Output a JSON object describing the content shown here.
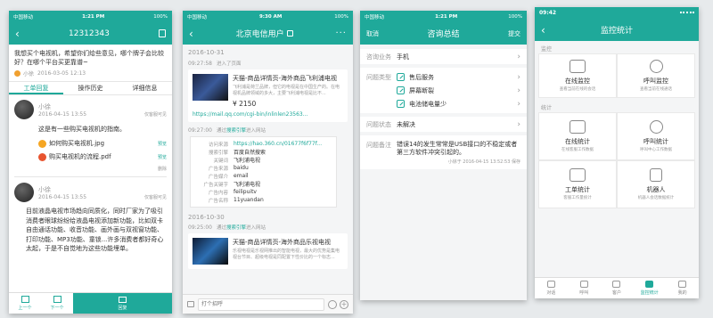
{
  "p1": {
    "status": {
      "carrier": "中国移动",
      "time": "1:21 PM",
      "battery": "100%"
    },
    "title": "12312343",
    "question": "我想买个电视机，希望你们给些意见，哪个牌子会比较好？在哪个平台买更靠谱~",
    "asker": "小徐",
    "asker_date": "2016-03-05 12:13",
    "tabs": [
      "工单回复",
      "操作历史",
      "详细信息"
    ],
    "r1": {
      "name": "小徐",
      "time": "2016-04-15 13:55",
      "tag": "仅客服可见",
      "text": "这是有一些购买电视机的指南。",
      "files": [
        {
          "name": "如何购买电视机.jpg",
          "action": "预览"
        },
        {
          "name": "购买电视机的流程.pdf",
          "action": "预览"
        }
      ],
      "delete": "删除"
    },
    "r2": {
      "name": "小徐",
      "time": "2016-04-15 13:55",
      "tag": "仅客服可见",
      "text": "目前液晶电视市场趋向同质化，同时厂家为了吸引消费者眼球纷纷给液晶电视添加新功能，比如双卡自由通话功能、收音功能、画外画与双视窗功能、打印功能、MP3功能、童锁...许多消费者都好奇心太起，于是不自觉地为这些功能埋单。"
    },
    "bottom": {
      "prev": "上一个",
      "next": "下一个",
      "reply": "回复"
    }
  },
  "p2": {
    "status": {
      "carrier": "中国移动",
      "time": "9:30 AM",
      "battery": "100%"
    },
    "title": "北京电信用户",
    "d1": "2016-10-31",
    "t1": "09:27:58",
    "ev1": "进入了页面",
    "card1": {
      "title": "天猫-商品详情页-海外商品飞利浦电视",
      "desc": "飞利浦是荷兰品牌，但它的电视是在中国生产的。在电视机品牌领域的多大，主要飞利浦电视是比不...",
      "price": "¥ 2150",
      "url": "https://mail.qq.com/cgi-bin/inlinlen23563..."
    },
    "t2": "09:27:00",
    "ev2_pre": "通过",
    "ev2_link": "搜索引擎",
    "ev2_post": "进入网站",
    "info": [
      [
        "访问来源",
        "https://hao.360.cn/01677f6f77f..."
      ],
      [
        "搜索引擎",
        "百度自然搜索"
      ],
      [
        "关键词",
        "飞利浦电视"
      ],
      [
        "广告来源",
        "baidu"
      ],
      [
        "广告媒介",
        "email"
      ],
      [
        "广告关键字",
        "飞利浦电视"
      ],
      [
        "广告内容",
        "feilipuitv"
      ],
      [
        "广告名称",
        "11yuandan"
      ]
    ],
    "d2": "2016-10-30",
    "t3": "09:25:00",
    "ev3_pre": "通过",
    "ev3_link": "搜索引擎",
    "ev3_post": "进入网站",
    "card2": {
      "title": "天猫-商品详情页-海外商品乐视电视",
      "desc": "乐视电视是乐视网推出的智能电视，最大的优势是集电视台节目、超级电视是同配置下性价比的一个标志..."
    },
    "input_placeholder": "打个招呼"
  },
  "p3": {
    "status": {
      "carrier": "中国移动",
      "time": "1:21 PM",
      "battery": "100%"
    },
    "cancel": "取消",
    "title": "咨询总结",
    "submit": "提交",
    "business": {
      "label": "咨询业务",
      "value": "手机"
    },
    "types": {
      "label": "问题类型",
      "values": [
        "售后服务",
        "屏幕断裂",
        "电池储电量少"
      ]
    },
    "state": {
      "label": "问题状态",
      "value": "未解决"
    },
    "note": {
      "label": "问题备注",
      "value": "错误14的发生常常是USB接口的不稳定或者第三方软件冲突引起的。",
      "meta": "小徐于 2016-04-15 13:52:53 保存"
    }
  },
  "p4": {
    "status": {
      "time": "09:42"
    },
    "title": "监控统计",
    "sec1": "监控",
    "sec2": "统计",
    "tiles": [
      {
        "t": "在线监控",
        "s": "查看当前在线的会话"
      },
      {
        "t": "呼叫监控",
        "s": "查看当前在线通话"
      },
      {
        "t": "在线统计",
        "s": "在线客服工作数据"
      },
      {
        "t": "呼叫统计",
        "s": "呼叫中心工作数据"
      },
      {
        "t": "工单统计",
        "s": "客服工作量统计"
      },
      {
        "t": "机器人",
        "s": "机器人会话数据统计"
      }
    ],
    "tabbar": [
      "对话",
      "呼叫",
      "客户",
      "监控统计",
      "我的"
    ]
  }
}
